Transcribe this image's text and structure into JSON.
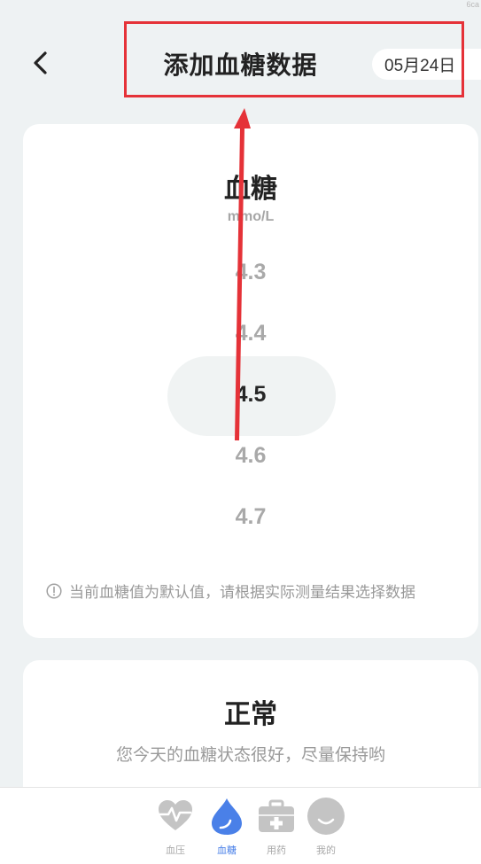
{
  "corner_mark": "6ca",
  "header": {
    "title": "添加血糖数据",
    "date": "05月24日"
  },
  "picker": {
    "title": "血糖",
    "unit": "mmo/L",
    "values": [
      "4.3",
      "4.4",
      "4.5",
      "4.6",
      "4.7"
    ],
    "selected_value": "4.5",
    "hint": "当前血糖值为默认值，请根据实际测量结果选择数据"
  },
  "status": {
    "title": "正常",
    "description": "您今天的血糖状态很好，尽量保持哟"
  },
  "bottom_nav": {
    "items": [
      {
        "label": "血压",
        "icon": "heart-pulse-icon",
        "active": false
      },
      {
        "label": "血糖",
        "icon": "blood-drop-icon",
        "active": true
      },
      {
        "label": "用药",
        "icon": "medicine-kit-icon",
        "active": false
      },
      {
        "label": "我的",
        "icon": "smiley-profile-icon",
        "active": false
      }
    ]
  },
  "colors": {
    "background": "#eef2f3",
    "annotation_red": "#e53238",
    "active_blue": "#4a80e8",
    "inactive_gray": "#c2c2c2"
  }
}
